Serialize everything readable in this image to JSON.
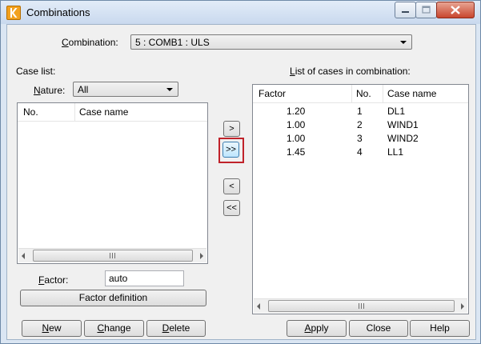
{
  "window": {
    "title": "Combinations"
  },
  "combination": {
    "label": "Combination:",
    "label_key": "C",
    "label_rest": "ombination:",
    "value": "5 : COMB1 : ULS"
  },
  "case_list": {
    "label": "Case list:",
    "nature_label_key": "N",
    "nature_label_rest": "ature:",
    "nature_value": "All",
    "columns": [
      "No.",
      "Case name"
    ],
    "rows": []
  },
  "factor": {
    "label_key": "F",
    "label_rest": "actor:",
    "value": "auto",
    "definition_button": "Factor definition"
  },
  "transfer_buttons": {
    "add_one": ">",
    "add_all": ">>",
    "remove_one": "<",
    "remove_all": "<<"
  },
  "combination_list": {
    "label_key": "L",
    "label_rest": "ist of cases in combination:",
    "columns": [
      "Factor",
      "No.",
      "Case name"
    ],
    "rows": [
      {
        "factor": "1.20",
        "no": "1",
        "name": "DL1"
      },
      {
        "factor": "1.00",
        "no": "2",
        "name": "WIND1"
      },
      {
        "factor": "1.00",
        "no": "3",
        "name": "WIND2"
      },
      {
        "factor": "1.45",
        "no": "4",
        "name": "LL1"
      }
    ]
  },
  "footer": {
    "new_key": "N",
    "new_rest": "ew",
    "change_key": "C",
    "change_rest": "hange",
    "delete_key": "D",
    "delete_rest": "elete",
    "apply_key": "A",
    "apply_rest": "pply",
    "close": "Close",
    "help": "Help"
  },
  "colors": {
    "highlight": "#c0222a",
    "app_icon": "#f2a11f",
    "close_button": "#c8462e"
  }
}
